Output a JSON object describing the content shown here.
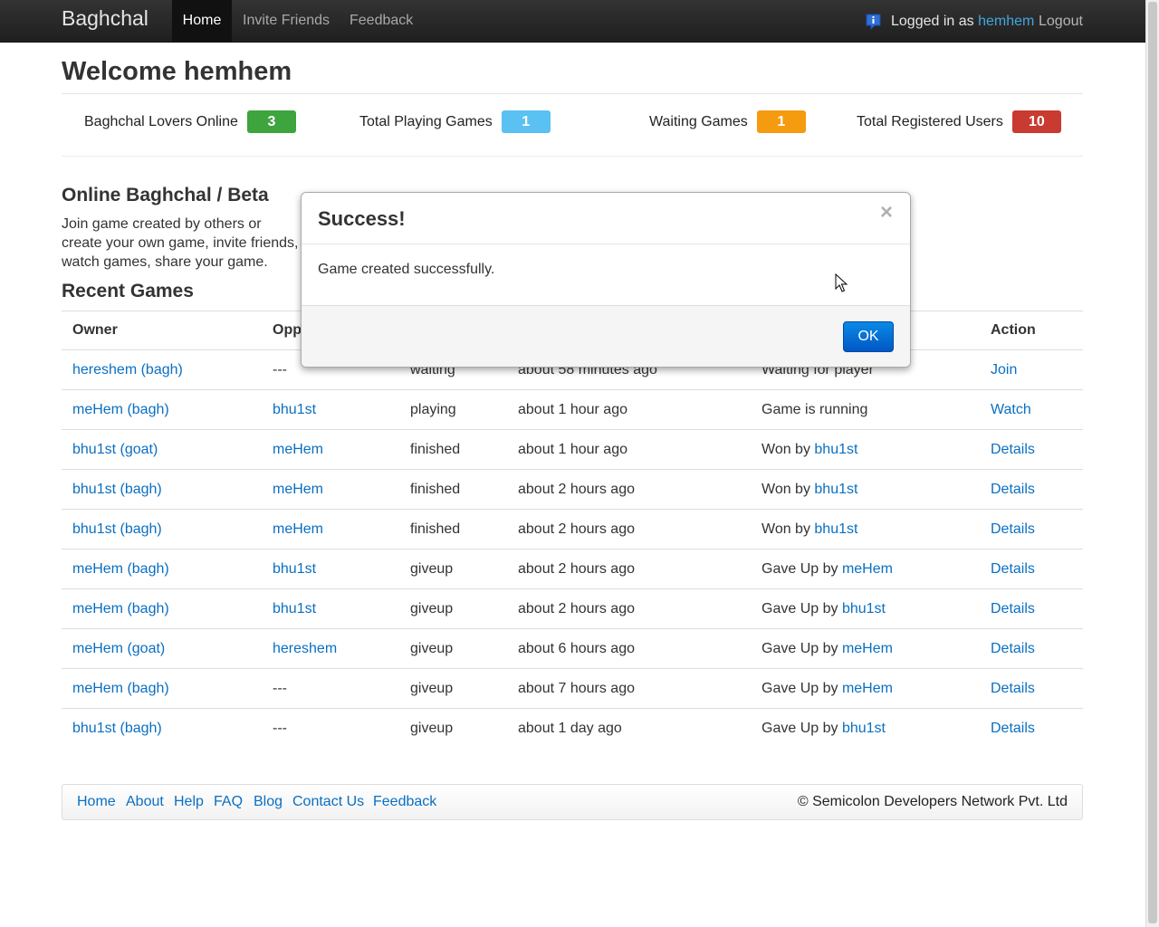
{
  "navbar": {
    "brand": "Baghchal",
    "items": [
      {
        "label": "Home",
        "active": true
      },
      {
        "label": "Invite Friends"
      },
      {
        "label": "Feedback"
      }
    ],
    "logged_in_prefix": "Logged in as ",
    "username": "hemhem",
    "logout": "Logout",
    "notification_icon": "notification-icon"
  },
  "header": {
    "welcome": "Welcome hemhem"
  },
  "stats": [
    {
      "label": "Baghchal Lovers Online",
      "value": "3",
      "color": "#3ea43e"
    },
    {
      "label": "Total Playing Games",
      "value": "1",
      "color": "#5bc0f2"
    },
    {
      "label": "Waiting Games",
      "value": "1",
      "color": "#f49b0f"
    },
    {
      "label": "Total Registered Users",
      "value": "10",
      "color": "#c93a31"
    }
  ],
  "intro": {
    "title": "Online Baghchal / Beta",
    "text": "Join game created by others or create your own game, invite friends, watch games, share your game."
  },
  "recent": {
    "title": "Recent Games",
    "columns": [
      "Owner",
      "Opp",
      "",
      "",
      "",
      "Action"
    ],
    "rows": [
      {
        "owner": "hereshem (bagh)",
        "opponent": "---",
        "status": "waiting",
        "time": "about 58 minutes ago",
        "result_text": "Waiting for player",
        "result_user": "",
        "action": "Join"
      },
      {
        "owner": "meHem (bagh)",
        "opponent": "bhu1st",
        "status": "playing",
        "time": "about 1 hour ago",
        "result_text": "Game is running",
        "result_user": "",
        "action": "Watch"
      },
      {
        "owner": "bhu1st (goat)",
        "opponent": "meHem",
        "status": "finished",
        "time": "about 1 hour ago",
        "result_text": "Won by ",
        "result_user": "bhu1st",
        "action": "Details"
      },
      {
        "owner": "bhu1st (bagh)",
        "opponent": "meHem",
        "status": "finished",
        "time": "about 2 hours ago",
        "result_text": "Won by ",
        "result_user": "bhu1st",
        "action": "Details"
      },
      {
        "owner": "bhu1st (bagh)",
        "opponent": "meHem",
        "status": "finished",
        "time": "about 2 hours ago",
        "result_text": "Won by ",
        "result_user": "bhu1st",
        "action": "Details"
      },
      {
        "owner": "meHem (bagh)",
        "opponent": "bhu1st",
        "status": "giveup",
        "time": "about 2 hours ago",
        "result_text": "Gave Up by ",
        "result_user": "meHem",
        "action": "Details"
      },
      {
        "owner": "meHem (bagh)",
        "opponent": "bhu1st",
        "status": "giveup",
        "time": "about 2 hours ago",
        "result_text": "Gave Up by ",
        "result_user": "bhu1st",
        "action": "Details"
      },
      {
        "owner": "meHem (goat)",
        "opponent": "hereshem",
        "status": "giveup",
        "time": "about 6 hours ago",
        "result_text": "Gave Up by ",
        "result_user": "meHem",
        "action": "Details"
      },
      {
        "owner": "meHem (bagh)",
        "opponent": "---",
        "status": "giveup",
        "time": "about 7 hours ago",
        "result_text": "Gave Up by ",
        "result_user": "meHem",
        "action": "Details"
      },
      {
        "owner": "bhu1st (bagh)",
        "opponent": "---",
        "status": "giveup",
        "time": "about 1 day ago",
        "result_text": "Gave Up by ",
        "result_user": "bhu1st",
        "action": "Details"
      }
    ]
  },
  "footer": {
    "links": [
      "Home",
      "About",
      "Help",
      "FAQ",
      "Blog",
      "Contact Us",
      "Feedback"
    ],
    "copyright": "© Semicolon Developers Network Pvt. Ltd"
  },
  "modal": {
    "title": "Success!",
    "close": "×",
    "message": "Game created successfully.",
    "ok": "OK"
  }
}
